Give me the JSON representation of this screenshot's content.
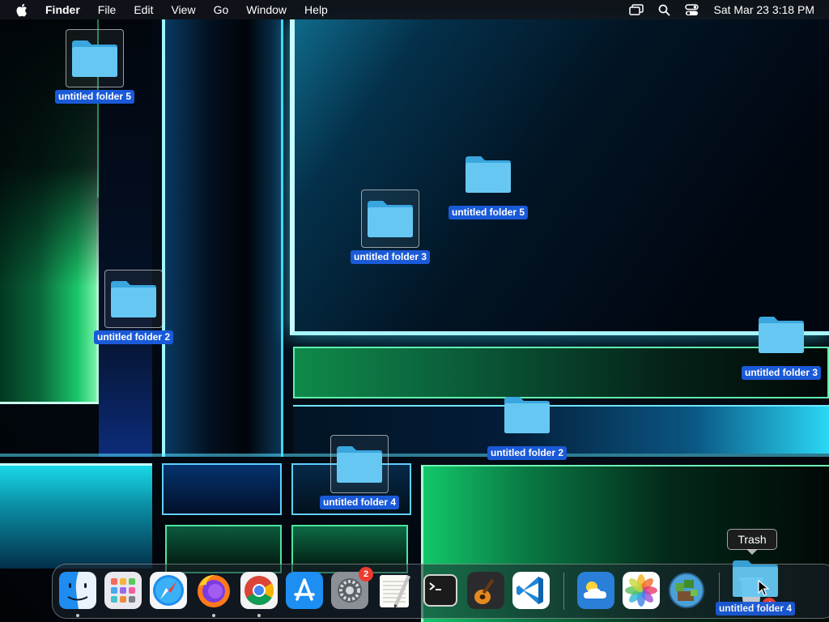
{
  "menubar": {
    "apple_icon": "apple-logo-icon",
    "app_name": "Finder",
    "menus": [
      "File",
      "Edit",
      "View",
      "Go",
      "Window",
      "Help"
    ],
    "status_icons": [
      "screen-mirroring-icon",
      "spotlight-search-icon",
      "control-center-icon"
    ],
    "clock": "Sat Mar 23  3:18 PM"
  },
  "desktop": {
    "folders": [
      {
        "label": "untitled folder 5",
        "selected": true
      },
      {
        "label": "untitled folder 2",
        "selected": true
      },
      {
        "label": "untitled folder 3",
        "selected": true
      },
      {
        "label": "untitled folder 5",
        "selected": false
      },
      {
        "label": "untitled folder 4",
        "selected": true
      },
      {
        "label": "untitled folder 2",
        "selected": false
      },
      {
        "label": "untitled folder 3",
        "selected": false
      }
    ]
  },
  "dock": {
    "apps": [
      {
        "name": "Finder",
        "icon": "finder-icon",
        "running": true
      },
      {
        "name": "Launchpad",
        "icon": "launchpad-icon",
        "running": false
      },
      {
        "name": "Safari",
        "icon": "safari-icon",
        "running": false
      },
      {
        "name": "Firefox",
        "icon": "firefox-icon",
        "running": true
      },
      {
        "name": "Chrome",
        "icon": "chrome-icon",
        "running": true
      },
      {
        "name": "App Store",
        "icon": "app-store-icon",
        "running": false
      },
      {
        "name": "System Settings",
        "icon": "system-settings-icon",
        "running": false,
        "badge": "2"
      },
      {
        "name": "TextEdit",
        "icon": "textedit-icon",
        "running": false
      },
      {
        "name": "Terminal",
        "icon": "terminal-icon",
        "running": false
      },
      {
        "name": "GarageBand",
        "icon": "garageband-icon",
        "running": false
      },
      {
        "name": "Visual Studio Code",
        "icon": "vscode-icon",
        "running": false
      },
      {
        "name": "Weather",
        "icon": "weather-icon",
        "running": false
      },
      {
        "name": "Photos",
        "icon": "photos-icon",
        "running": false
      },
      {
        "name": "Minecraft",
        "icon": "minecraft-icon",
        "running": false
      }
    ],
    "trash": {
      "tooltip": "Trash",
      "badge": "4"
    }
  },
  "drag": {
    "label": "untitled folder 4"
  },
  "colors": {
    "selection_blue": "#1a5ad8",
    "folder_blue": "#5bc2ee",
    "badge_red": "#ee3b30"
  }
}
